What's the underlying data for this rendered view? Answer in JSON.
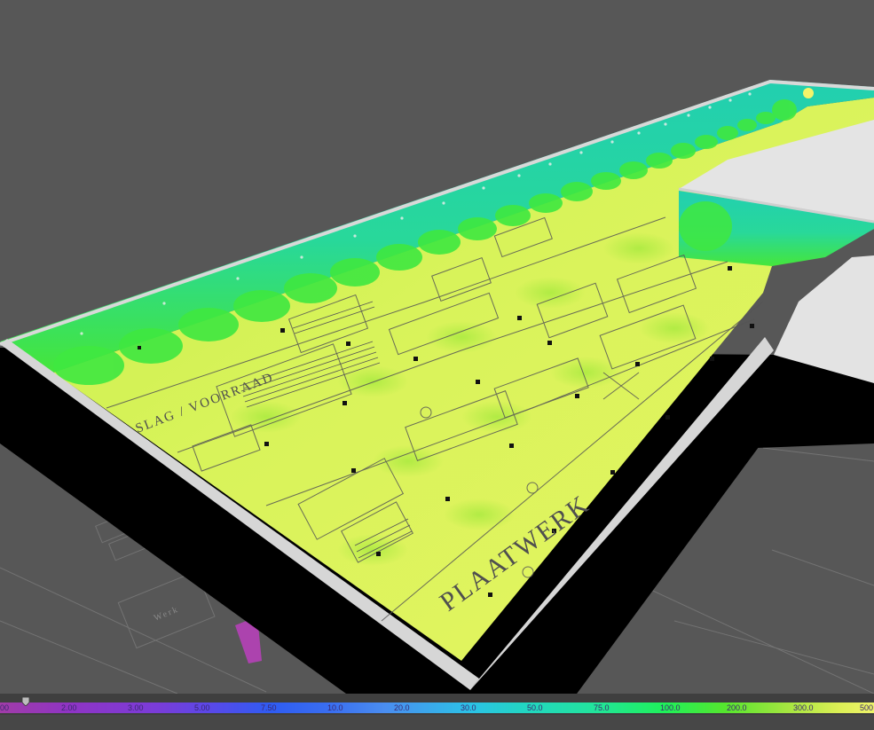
{
  "scene": {
    "room_labels": {
      "plaatwerk": "PLAATWERK",
      "opslag": "SLAG / VOORRAAD",
      "side_room": "Werk"
    },
    "colors": {
      "background": "#575757",
      "floor_high": "#e2f25c",
      "floor_mid": "#b8ec3c",
      "wall_low": "#2ad8a0",
      "wall_high": "#3ee83a",
      "wall_top": "#dcdcdc",
      "wall_side": "#000000"
    }
  },
  "legend": {
    "ticks": [
      "00",
      "2.00",
      "3.00",
      "5.00",
      "7.50",
      "10.0",
      "20.0",
      "30.0",
      "50.0",
      "75.0",
      "100.0",
      "200.0",
      "300.0",
      "500"
    ],
    "slider_icon": "slider-thumb-icon"
  }
}
